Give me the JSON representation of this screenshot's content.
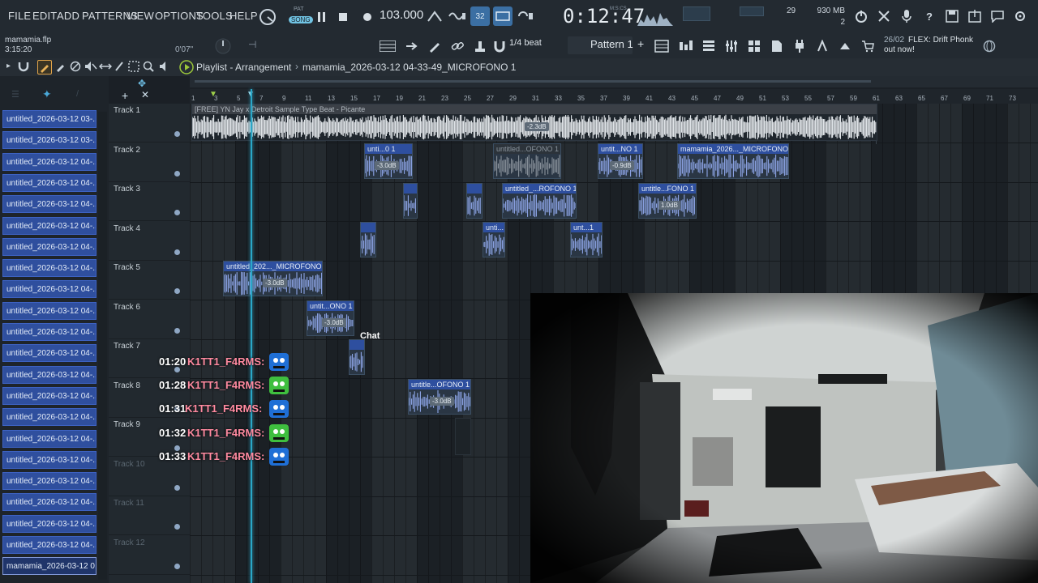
{
  "menu": {
    "file": "FILE",
    "edit": "EDIT",
    "add": "ADD",
    "patterns": "PATTERNS",
    "view": "VIEW",
    "options": "OPTIONS",
    "tools": "TOOLS",
    "help": "HELP"
  },
  "transport": {
    "mode_pat": "PAT",
    "mode_song": "SONG",
    "tempo": "103.000",
    "song_time": "0:12:47",
    "time_format": "M:S:CS",
    "step_display": "32"
  },
  "cpu": {
    "value": "29",
    "memory": "930 MB",
    "polyphony": "2"
  },
  "project": {
    "file_name": "mamamia.flp",
    "length": "3:15:20",
    "hint_time": "0'07\""
  },
  "toolbar2": {
    "snap": "1/4 beat",
    "pattern": "Pattern 1",
    "pattern_add": "+"
  },
  "news": {
    "date": "26/02",
    "text": "FLEX: Drift Phonk",
    "subtitle": "out now!"
  },
  "playlist": {
    "title": "Playlist - Arrangement",
    "separator": "›",
    "clip_name": "mamamia_2026-03-12 04-33-49_MICROFONO 1"
  },
  "ruler": [
    "1",
    "3",
    "5",
    "7",
    "9",
    "11",
    "13",
    "15",
    "17",
    "19",
    "21",
    "23",
    "25",
    "27",
    "29",
    "31",
    "33",
    "35",
    "37",
    "39",
    "41",
    "43",
    "45",
    "47",
    "49",
    "51",
    "53",
    "55",
    "57",
    "59",
    "61",
    "63",
    "65",
    "67",
    "69",
    "71",
    "73"
  ],
  "browser": {
    "items": [
      "untitled_2026-03-12 03-...",
      "untitled_2026-03-12 03-...",
      "untitled_2026-03-12 04-...",
      "untitled_2026-03-12 04-...",
      "untitled_2026-03-12 04-...",
      "untitled_2026-03-12 04-...",
      "untitled_2026-03-12 04-...",
      "untitled_2026-03-12 04-...",
      "untitled_2026-03-12 04-...",
      "untitled_2026-03-12 04-...",
      "untitled_2026-03-12 04-...",
      "untitled_2026-03-12 04-...",
      "untitled_2026-03-12 04-...",
      "untitled_2026-03-12 04-...",
      "untitled_2026-03-12 04-...",
      "untitled_2026-03-12 04-...",
      "untitled_2026-03-12 04-...",
      "untitled_2026-03-12 04-...",
      "untitled_2026-03-12 04-...",
      "untitled_2026-03-12 04-...",
      "untitled_2026-03-12 04-...",
      "mamamia_2026-03-12 0..."
    ]
  },
  "tracks": [
    "Track 1",
    "Track 2",
    "Track 3",
    "Track 4",
    "Track 5",
    "Track 6",
    "Track 7",
    "Track 8",
    "Track 9",
    "Track 10",
    "Track 11",
    "Track 12"
  ],
  "clips": {
    "sample": "[FREE] YN Jay x Detroit Sample Type Beat - Picante",
    "sample_gain": "-2.3dB",
    "t2a": "unti...0 1",
    "t2a_gain": "-3.0dB",
    "t2b": "untitled...OFONO 1",
    "t2c": "untit...NO 1",
    "t2c_gain": "-0.9dB",
    "t2d": "mamamia_2026..._MICROFONO 1",
    "t3a": "",
    "t3b": "",
    "t3c": "untitled_...ROFONO 1",
    "t3d": "untitle...FONO 1",
    "t3d_gain": "1.0dB",
    "t4a": "",
    "t4b": "unti...",
    "t4c": "unt...1",
    "t5a": "untitled_202..._MICROFONO 1",
    "t5a_gain": "-3.0dB",
    "t6a": "untit...ONO 1",
    "t6a_gain": "-3.0dB",
    "t7a": "",
    "t8a": "untitle...OFONO 1",
    "t8a_gain": "-3.0dB"
  },
  "chat": {
    "label": "Chat",
    "messages": [
      {
        "time": "01:20",
        "user": "K1TT1_F4RMS:"
      },
      {
        "time": "01:28",
        "user": "K1TT1_F4RMS:"
      },
      {
        "time": "01:31",
        "user": "K1TT1_F4RMS:"
      },
      {
        "time": "01:32",
        "user": "K1TT1_F4RMS:"
      },
      {
        "time": "01:33",
        "user": "K1TT1_F4RMS:"
      }
    ]
  },
  "colors": {
    "clip_header": "#2e4f9f",
    "clip_wave": "#8ea6e8",
    "playhead": "#2aa7c8",
    "chat_user": "#ff8aa0"
  }
}
